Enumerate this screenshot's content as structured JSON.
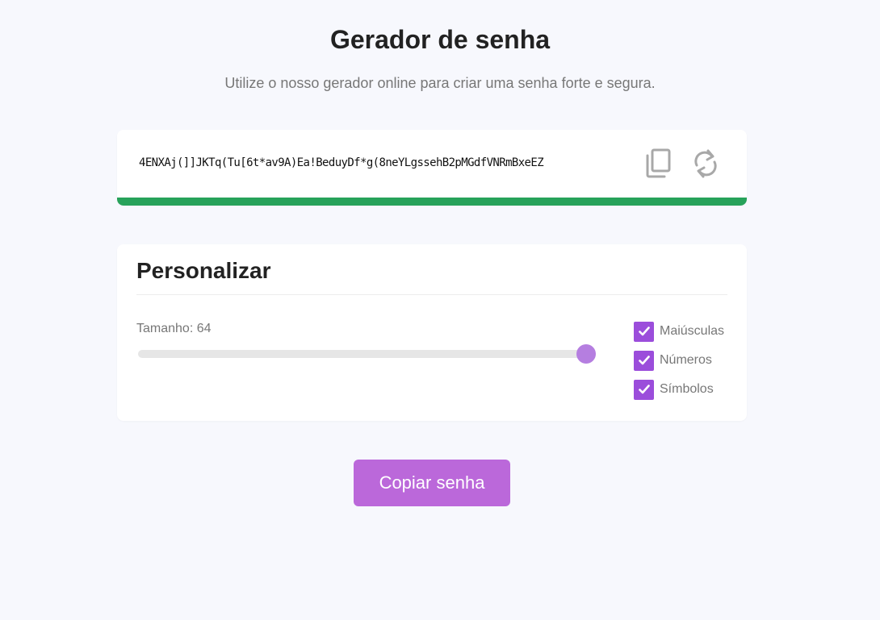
{
  "header": {
    "title": "Gerador de senha",
    "subtitle": "Utilize o nosso gerador online para criar uma senha forte e segura."
  },
  "password": {
    "value": "4ENXAj(]]JKTq(Tu[6t*av9A)Ea!BeduyDf*g(8neYLgssehB2pMGdfVNRmBxeEZ",
    "copy_icon": "copy-icon",
    "refresh_icon": "refresh-icon",
    "strength_color": "#27a25a"
  },
  "customize": {
    "title": "Personalizar",
    "length_label": "Tamanho: 64",
    "length_value": 64,
    "options": [
      {
        "label": "Maiúsculas",
        "checked": true
      },
      {
        "label": "Números",
        "checked": true
      },
      {
        "label": "Símbolos",
        "checked": true
      }
    ]
  },
  "actions": {
    "copy_label": "Copiar senha"
  },
  "colors": {
    "accent": "#bb68da",
    "checkbox": "#9b4ddb",
    "slider_thumb": "#b57ee0",
    "background": "#f7f8fd"
  }
}
